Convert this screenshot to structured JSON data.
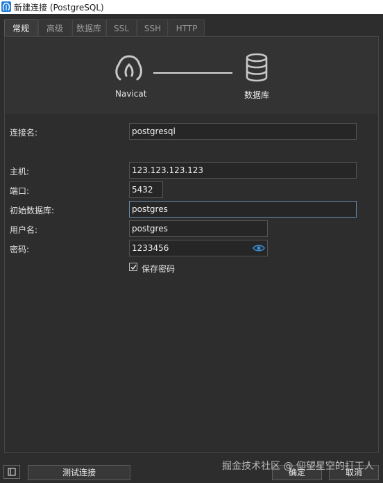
{
  "window": {
    "title": "新建连接 (PostgreSQL)"
  },
  "tabs": [
    {
      "label": "常规",
      "active": true
    },
    {
      "label": "高级",
      "active": false
    },
    {
      "label": "数据库",
      "active": false
    },
    {
      "label": "SSL",
      "active": false
    },
    {
      "label": "SSH",
      "active": false
    },
    {
      "label": "HTTP",
      "active": false
    }
  ],
  "banner": {
    "left_label": "Navicat",
    "right_label": "数据库"
  },
  "form": {
    "connection_name": {
      "label": "连接名:",
      "value": "postgresql"
    },
    "host": {
      "label": "主机:",
      "value": "123.123.123.123"
    },
    "port": {
      "label": "端口:",
      "value": "5432"
    },
    "initial_db": {
      "label": "初始数据库:",
      "value": "postgres"
    },
    "username": {
      "label": "用户名:",
      "value": "postgres"
    },
    "password": {
      "label": "密码:",
      "value": "1233456"
    },
    "save_password": {
      "label": "保存密码",
      "checked": true
    }
  },
  "buttons": {
    "test": "测试连接",
    "ok": "确定",
    "cancel": "取消"
  },
  "watermark": "掘金技术社区 @ 仰望星空的打工人",
  "colors": {
    "accent": "#3a8fd6",
    "background": "#2d2d2d"
  }
}
